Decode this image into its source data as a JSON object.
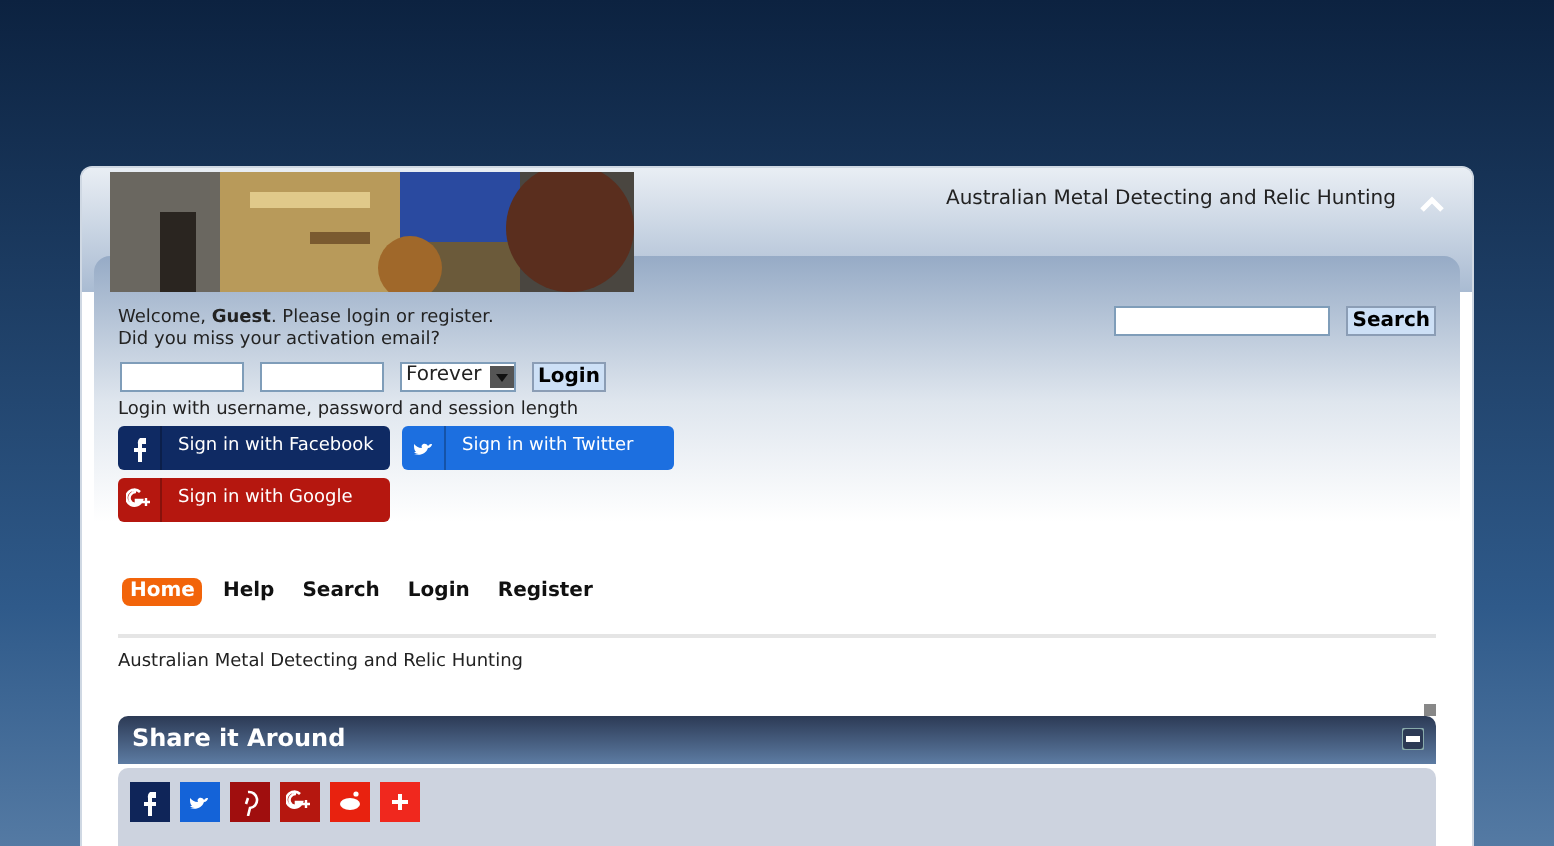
{
  "header": {
    "site_title": "Australian Metal Detecting and Relic Hunting"
  },
  "user_panel": {
    "welcome": "Welcome, **Guest**. Please login or register.",
    "activation": "Did you miss your activation email?",
    "session_option": "Forever",
    "login_button": "Login",
    "hint": "Login with username, password and session length"
  },
  "search": {
    "button": "Search"
  },
  "social_logins": [
    {
      "kind": "f",
      "label": "Sign in with Facebook",
      "color": "#0f2a63"
    },
    {
      "kind": "bird",
      "label": "Sign in with Twitter",
      "color": "#1c6fe0"
    },
    {
      "kind": "g",
      "label": "Sign in with Google",
      "color": "#b5170f"
    }
  ],
  "menu": [
    {
      "label": "Home",
      "selected": true
    },
    {
      "label": "Help",
      "selected": false
    },
    {
      "label": "Search",
      "selected": false
    },
    {
      "label": "Login",
      "selected": false
    },
    {
      "label": "Register",
      "selected": false
    }
  ],
  "breadcrumb": "Australian Metal Detecting and Relic Hunting",
  "share_panel": {
    "title": "Share it Around",
    "buttons": [
      {
        "kind": "f",
        "color": "#0f2559"
      },
      {
        "kind": "bird",
        "color": "#1463d8"
      },
      {
        "kind": "pin",
        "color": "#a00e0e"
      },
      {
        "kind": "g",
        "color": "#b5170f"
      },
      {
        "kind": "alien",
        "color": "#e8220f"
      },
      {
        "kind": "plus",
        "color": "#f0281e"
      }
    ]
  }
}
